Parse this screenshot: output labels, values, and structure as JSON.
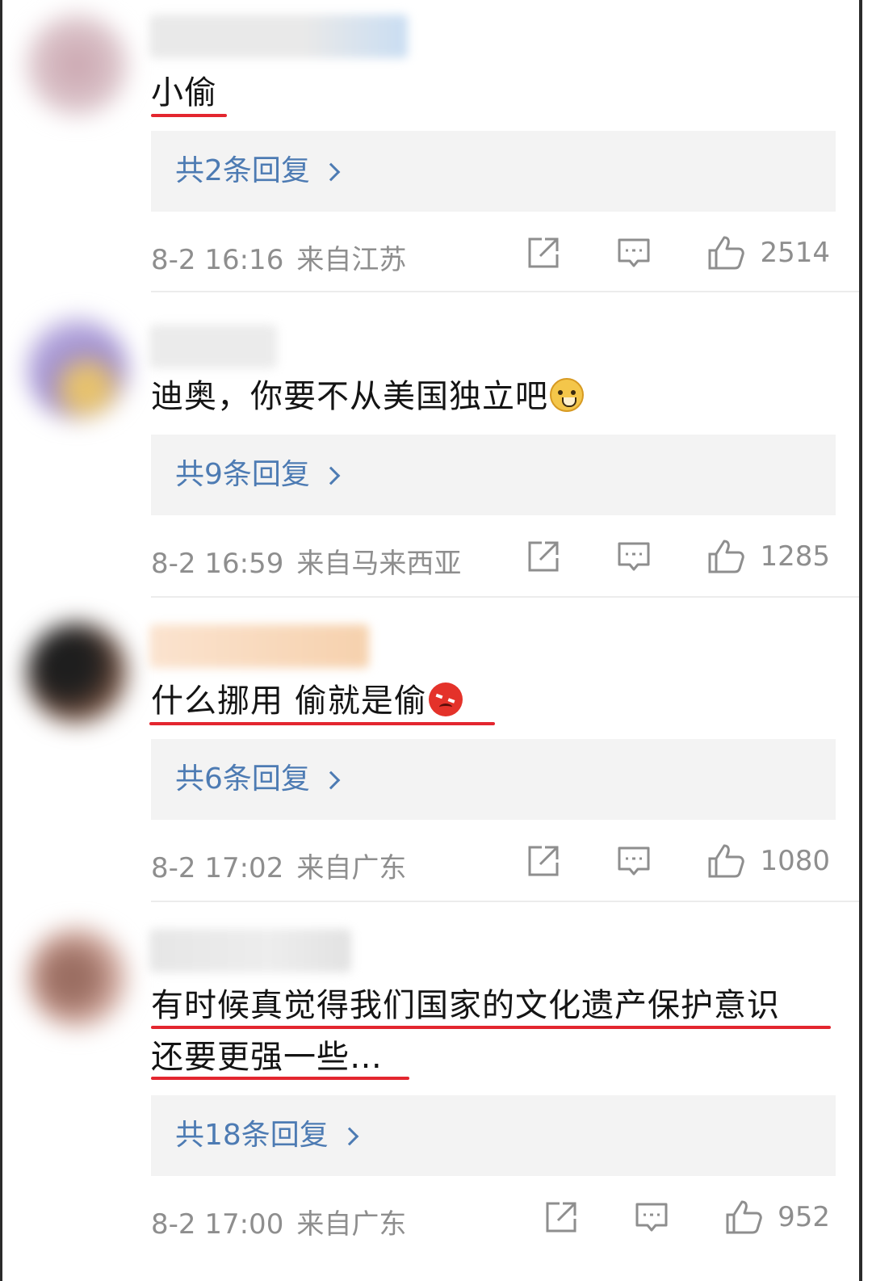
{
  "comments": [
    {
      "text_lines": [
        "小偷"
      ],
      "emoji": "",
      "replies": "共2条回复",
      "time": "8-2 16:16",
      "location": "来自江苏",
      "likes": "2514"
    },
    {
      "text_lines": [
        "迪奥，你要不从美国独立吧"
      ],
      "emoji": "doge-emoji",
      "replies": "共9条回复",
      "time": "8-2 16:59",
      "location": "来自马来西亚",
      "likes": "1285"
    },
    {
      "text_lines": [
        "什么挪用 偷就是偷"
      ],
      "emoji": "angry-emoji",
      "replies": "共6条回复",
      "time": "8-2 17:02",
      "location": "来自广东",
      "likes": "1080"
    },
    {
      "text_lines": [
        "有时候真觉得我们国家的文化遗产保护意识",
        "还要更强一些…"
      ],
      "emoji": "",
      "replies": "共18条回复",
      "time": "8-2 17:00",
      "location": "来自广东",
      "likes": "952"
    }
  ],
  "icons": [
    "share-icon",
    "comment-icon",
    "like-icon"
  ],
  "colors": {
    "reply_link": "#4d7bb3",
    "underline": "#e3262f",
    "meta": "#8e8e8e",
    "reply_bg": "#f3f3f3"
  }
}
